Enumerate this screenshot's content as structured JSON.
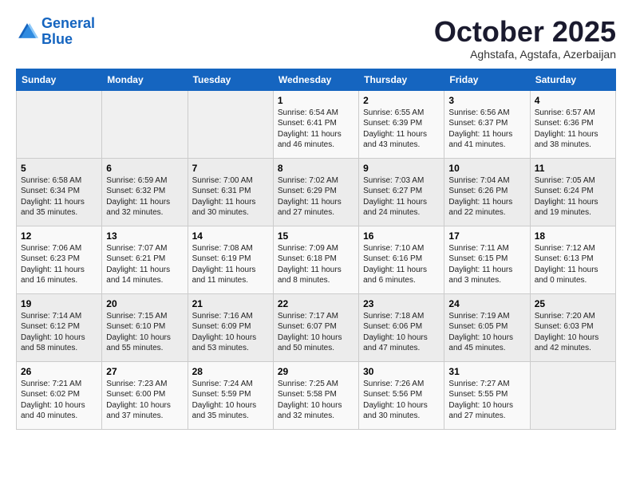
{
  "header": {
    "logo_line1": "General",
    "logo_line2": "Blue",
    "month_title": "October 2025",
    "subtitle": "Aghstafa, Agstafa, Azerbaijan"
  },
  "weekdays": [
    "Sunday",
    "Monday",
    "Tuesday",
    "Wednesday",
    "Thursday",
    "Friday",
    "Saturday"
  ],
  "weeks": [
    [
      {
        "day": "",
        "sunrise": "",
        "sunset": "",
        "daylight": ""
      },
      {
        "day": "",
        "sunrise": "",
        "sunset": "",
        "daylight": ""
      },
      {
        "day": "",
        "sunrise": "",
        "sunset": "",
        "daylight": ""
      },
      {
        "day": "1",
        "sunrise": "Sunrise: 6:54 AM",
        "sunset": "Sunset: 6:41 PM",
        "daylight": "Daylight: 11 hours and 46 minutes."
      },
      {
        "day": "2",
        "sunrise": "Sunrise: 6:55 AM",
        "sunset": "Sunset: 6:39 PM",
        "daylight": "Daylight: 11 hours and 43 minutes."
      },
      {
        "day": "3",
        "sunrise": "Sunrise: 6:56 AM",
        "sunset": "Sunset: 6:37 PM",
        "daylight": "Daylight: 11 hours and 41 minutes."
      },
      {
        "day": "4",
        "sunrise": "Sunrise: 6:57 AM",
        "sunset": "Sunset: 6:36 PM",
        "daylight": "Daylight: 11 hours and 38 minutes."
      }
    ],
    [
      {
        "day": "5",
        "sunrise": "Sunrise: 6:58 AM",
        "sunset": "Sunset: 6:34 PM",
        "daylight": "Daylight: 11 hours and 35 minutes."
      },
      {
        "day": "6",
        "sunrise": "Sunrise: 6:59 AM",
        "sunset": "Sunset: 6:32 PM",
        "daylight": "Daylight: 11 hours and 32 minutes."
      },
      {
        "day": "7",
        "sunrise": "Sunrise: 7:00 AM",
        "sunset": "Sunset: 6:31 PM",
        "daylight": "Daylight: 11 hours and 30 minutes."
      },
      {
        "day": "8",
        "sunrise": "Sunrise: 7:02 AM",
        "sunset": "Sunset: 6:29 PM",
        "daylight": "Daylight: 11 hours and 27 minutes."
      },
      {
        "day": "9",
        "sunrise": "Sunrise: 7:03 AM",
        "sunset": "Sunset: 6:27 PM",
        "daylight": "Daylight: 11 hours and 24 minutes."
      },
      {
        "day": "10",
        "sunrise": "Sunrise: 7:04 AM",
        "sunset": "Sunset: 6:26 PM",
        "daylight": "Daylight: 11 hours and 22 minutes."
      },
      {
        "day": "11",
        "sunrise": "Sunrise: 7:05 AM",
        "sunset": "Sunset: 6:24 PM",
        "daylight": "Daylight: 11 hours and 19 minutes."
      }
    ],
    [
      {
        "day": "12",
        "sunrise": "Sunrise: 7:06 AM",
        "sunset": "Sunset: 6:23 PM",
        "daylight": "Daylight: 11 hours and 16 minutes."
      },
      {
        "day": "13",
        "sunrise": "Sunrise: 7:07 AM",
        "sunset": "Sunset: 6:21 PM",
        "daylight": "Daylight: 11 hours and 14 minutes."
      },
      {
        "day": "14",
        "sunrise": "Sunrise: 7:08 AM",
        "sunset": "Sunset: 6:19 PM",
        "daylight": "Daylight: 11 hours and 11 minutes."
      },
      {
        "day": "15",
        "sunrise": "Sunrise: 7:09 AM",
        "sunset": "Sunset: 6:18 PM",
        "daylight": "Daylight: 11 hours and 8 minutes."
      },
      {
        "day": "16",
        "sunrise": "Sunrise: 7:10 AM",
        "sunset": "Sunset: 6:16 PM",
        "daylight": "Daylight: 11 hours and 6 minutes."
      },
      {
        "day": "17",
        "sunrise": "Sunrise: 7:11 AM",
        "sunset": "Sunset: 6:15 PM",
        "daylight": "Daylight: 11 hours and 3 minutes."
      },
      {
        "day": "18",
        "sunrise": "Sunrise: 7:12 AM",
        "sunset": "Sunset: 6:13 PM",
        "daylight": "Daylight: 11 hours and 0 minutes."
      }
    ],
    [
      {
        "day": "19",
        "sunrise": "Sunrise: 7:14 AM",
        "sunset": "Sunset: 6:12 PM",
        "daylight": "Daylight: 10 hours and 58 minutes."
      },
      {
        "day": "20",
        "sunrise": "Sunrise: 7:15 AM",
        "sunset": "Sunset: 6:10 PM",
        "daylight": "Daylight: 10 hours and 55 minutes."
      },
      {
        "day": "21",
        "sunrise": "Sunrise: 7:16 AM",
        "sunset": "Sunset: 6:09 PM",
        "daylight": "Daylight: 10 hours and 53 minutes."
      },
      {
        "day": "22",
        "sunrise": "Sunrise: 7:17 AM",
        "sunset": "Sunset: 6:07 PM",
        "daylight": "Daylight: 10 hours and 50 minutes."
      },
      {
        "day": "23",
        "sunrise": "Sunrise: 7:18 AM",
        "sunset": "Sunset: 6:06 PM",
        "daylight": "Daylight: 10 hours and 47 minutes."
      },
      {
        "day": "24",
        "sunrise": "Sunrise: 7:19 AM",
        "sunset": "Sunset: 6:05 PM",
        "daylight": "Daylight: 10 hours and 45 minutes."
      },
      {
        "day": "25",
        "sunrise": "Sunrise: 7:20 AM",
        "sunset": "Sunset: 6:03 PM",
        "daylight": "Daylight: 10 hours and 42 minutes."
      }
    ],
    [
      {
        "day": "26",
        "sunrise": "Sunrise: 7:21 AM",
        "sunset": "Sunset: 6:02 PM",
        "daylight": "Daylight: 10 hours and 40 minutes."
      },
      {
        "day": "27",
        "sunrise": "Sunrise: 7:23 AM",
        "sunset": "Sunset: 6:00 PM",
        "daylight": "Daylight: 10 hours and 37 minutes."
      },
      {
        "day": "28",
        "sunrise": "Sunrise: 7:24 AM",
        "sunset": "Sunset: 5:59 PM",
        "daylight": "Daylight: 10 hours and 35 minutes."
      },
      {
        "day": "29",
        "sunrise": "Sunrise: 7:25 AM",
        "sunset": "Sunset: 5:58 PM",
        "daylight": "Daylight: 10 hours and 32 minutes."
      },
      {
        "day": "30",
        "sunrise": "Sunrise: 7:26 AM",
        "sunset": "Sunset: 5:56 PM",
        "daylight": "Daylight: 10 hours and 30 minutes."
      },
      {
        "day": "31",
        "sunrise": "Sunrise: 7:27 AM",
        "sunset": "Sunset: 5:55 PM",
        "daylight": "Daylight: 10 hours and 27 minutes."
      },
      {
        "day": "",
        "sunrise": "",
        "sunset": "",
        "daylight": ""
      }
    ]
  ]
}
